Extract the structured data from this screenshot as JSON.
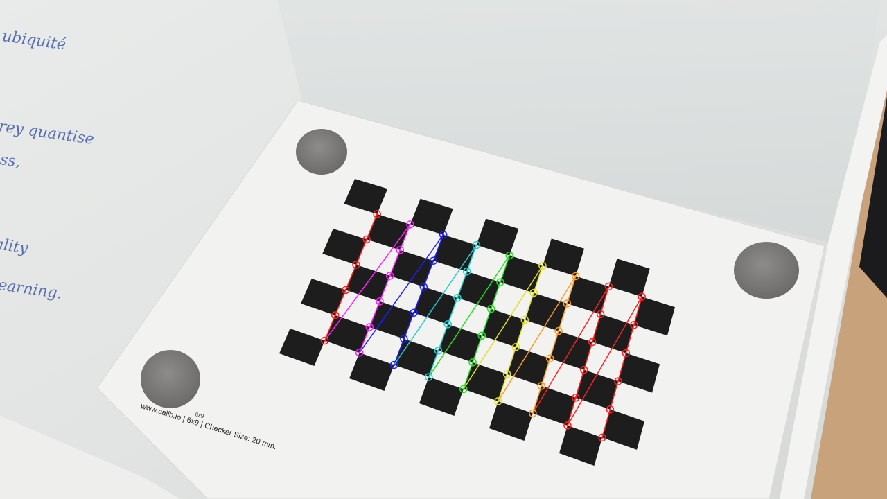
{
  "photo": {
    "caption": "www.calib.io | 6x9 | Checker Size: 20 mm.",
    "caption_note": "6x9",
    "board": {
      "rows": 6,
      "cols": 9,
      "checker_size_mm": 20
    },
    "handwriting": [
      "ubiquité",
      "rey quantise",
      "ss,",
      "ality",
      "learning."
    ],
    "magnets": 3,
    "corner_colors": [
      "#ff2020",
      "#ff20ff",
      "#2020ff",
      "#20d0d0",
      "#20e020",
      "#e0e020",
      "#ff9a20",
      "#ff2020"
    ]
  }
}
